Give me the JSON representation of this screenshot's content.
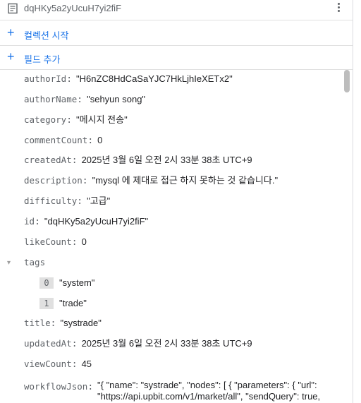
{
  "document": {
    "id": "dqHKy5a2yUcuH7yi2fiF",
    "more_icon": "more-vert-icon",
    "doc_icon": "document-icon"
  },
  "actions": {
    "add_collection": "컬렉션 시작",
    "add_field": "필드 추가",
    "icon": "plus-icon",
    "accent": "#1a73e8"
  },
  "fields": {
    "authorId": {
      "key": "authorId",
      "value": "\"H6nZC8HdCaSaYJC7HkLjhIeXETx2\""
    },
    "authorName": {
      "key": "authorName",
      "value": "\"sehyun song\""
    },
    "category": {
      "key": "category",
      "value": "\"메시지 전송\""
    },
    "commentCount": {
      "key": "commentCount",
      "value": "0"
    },
    "createdAt": {
      "key": "createdAt",
      "value": "2025년 3월 6일 오전 2시 33분 38초 UTC+9"
    },
    "description": {
      "key": "description",
      "value": "\"mysql 에 제대로 접근 하지 못하는 것 같습니다.\""
    },
    "difficulty": {
      "key": "difficulty",
      "value": "\"고급\""
    },
    "id": {
      "key": "id",
      "value": "\"dqHKy5a2yUcuH7yi2fiF\""
    },
    "likeCount": {
      "key": "likeCount",
      "value": "0"
    },
    "tags": {
      "key": "tags",
      "items": [
        {
          "index": "0",
          "value": "\"system\""
        },
        {
          "index": "1",
          "value": "\"trade\""
        }
      ]
    },
    "title": {
      "key": "title",
      "value": "\"systrade\""
    },
    "updatedAt": {
      "key": "updatedAt",
      "value": "2025년 3월 6일 오전 2시 33분 38초 UTC+9"
    },
    "viewCount": {
      "key": "viewCount",
      "value": "45"
    },
    "workflowJson": {
      "key": "workflowJson",
      "value": "\"{ \"name\": \"systrade\", \"nodes\": [ { \"parameters\": { \"url\": \"https://api.upbit.com/v1/market/all\", \"sendQuery\": true,"
    }
  },
  "colon": ":"
}
